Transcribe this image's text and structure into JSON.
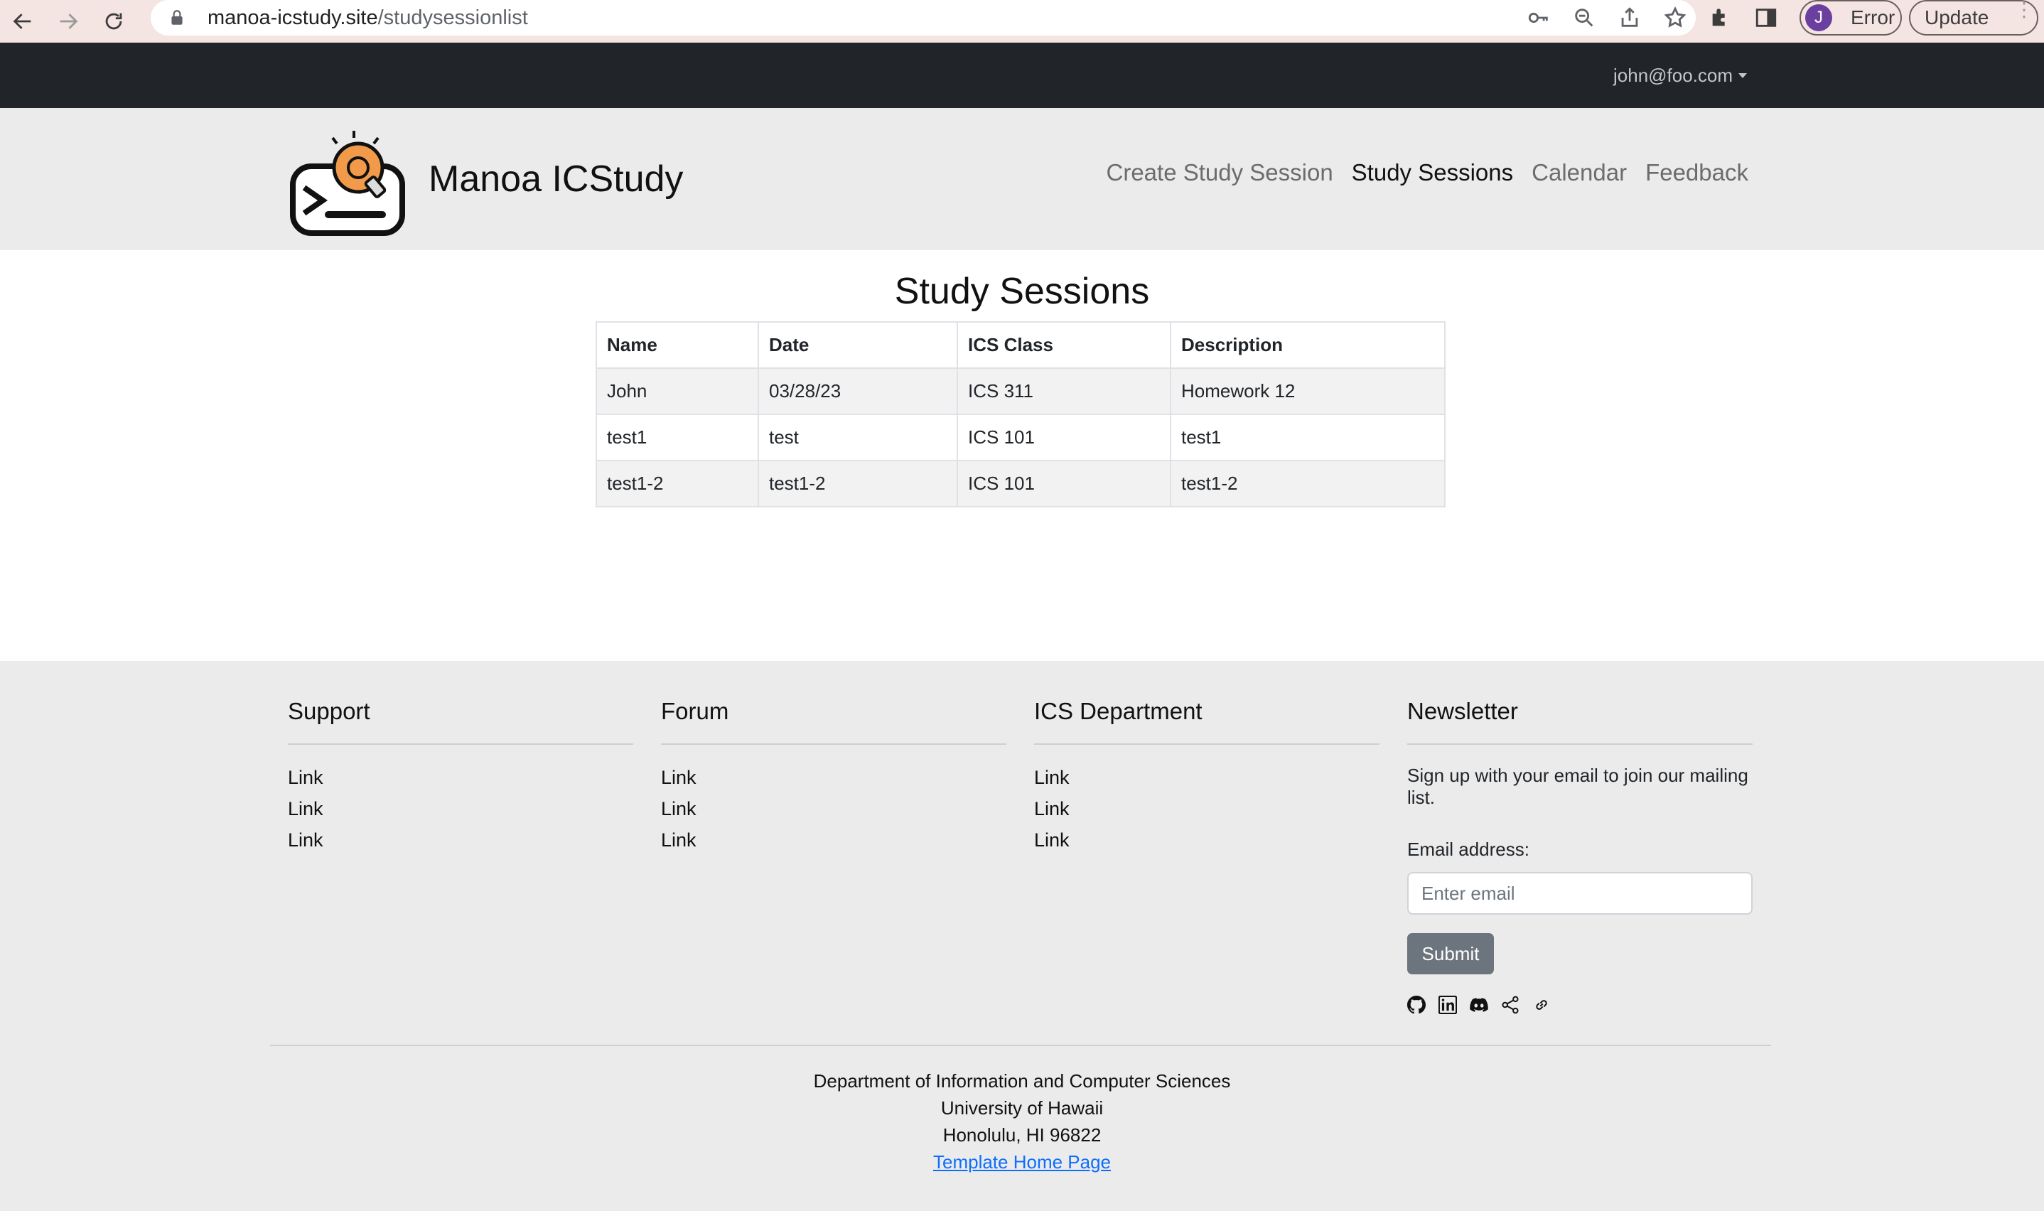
{
  "browser": {
    "url_domain": "manoa-icstudy.site",
    "url_path": "/studysessionlist",
    "profile_initial": "J",
    "profile_status": "Error",
    "update_label": "Update"
  },
  "topbar": {
    "user_email": "john@foo.com"
  },
  "header": {
    "brand": "Manoa ICStudy",
    "nav": [
      {
        "label": "Create Study Session"
      },
      {
        "label": "Study Sessions"
      },
      {
        "label": "Calendar"
      },
      {
        "label": "Feedback"
      }
    ]
  },
  "main": {
    "title": "Study Sessions",
    "columns": [
      "Name",
      "Date",
      "ICS Class",
      "Description"
    ],
    "rows": [
      [
        "John",
        "03/28/23",
        "ICS 311",
        "Homework 12"
      ],
      [
        "test1",
        "test",
        "ICS 101",
        "test1"
      ],
      [
        "test1-2",
        "test1-2",
        "ICS 101",
        "test1-2"
      ]
    ]
  },
  "footer": {
    "columns": [
      {
        "heading": "Support",
        "links": [
          "Link",
          "Link",
          "Link"
        ]
      },
      {
        "heading": "Forum",
        "links": [
          "Link",
          "Link",
          "Link"
        ]
      },
      {
        "heading": "ICS Department",
        "links": [
          "Link",
          "Link",
          "Link"
        ]
      }
    ],
    "newsletter": {
      "heading": "Newsletter",
      "text": "Sign up with your email to join our mailing list.",
      "email_label": "Email address:",
      "email_placeholder": "Enter email",
      "submit_label": "Submit",
      "social_icons": [
        "github-icon",
        "linkedin-icon",
        "discord-icon",
        "share-icon",
        "link-icon"
      ]
    },
    "address": [
      "Department of Information and Computer Sciences",
      "University of Hawaii",
      "Honolulu, HI 96822"
    ],
    "template_link": "Template Home Page"
  }
}
